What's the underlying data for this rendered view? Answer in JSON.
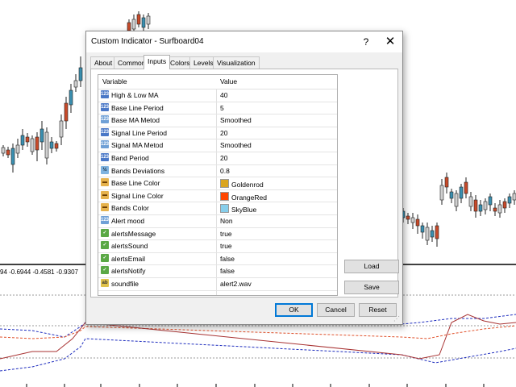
{
  "background": {
    "indicator_readout": "94 -0.6944 -0.4581 -0.9307",
    "line_colors": {
      "blue": "#1e2dbe",
      "red": "#e0502a",
      "brown": "#a83232"
    }
  },
  "dialog": {
    "title": "Custom Indicator - Surfboard04",
    "help_label": "?",
    "close_label": "✕",
    "tabs": [
      {
        "label": "About",
        "active": false
      },
      {
        "label": "Common",
        "active": false
      },
      {
        "label": "Inputs",
        "active": true
      },
      {
        "label": "Colors",
        "active": false
      },
      {
        "label": "Levels",
        "active": false
      },
      {
        "label": "Visualization",
        "active": false
      }
    ],
    "grid": {
      "headers": {
        "variable": "Variable",
        "value": "Value"
      },
      "rows": [
        {
          "name": "High & Low MA",
          "value": "40",
          "icon": "integer-icon",
          "icon_text": "123"
        },
        {
          "name": "Base Line Period",
          "value": "5",
          "icon": "integer-icon",
          "icon_text": "123"
        },
        {
          "name": "Base MA Metod",
          "value": "Smoothed",
          "icon": "enum-icon",
          "icon_text": "123"
        },
        {
          "name": "Signal Line Period",
          "value": "20",
          "icon": "integer-icon",
          "icon_text": "123"
        },
        {
          "name": "Signal MA Metod",
          "value": "Smoothed",
          "icon": "enum-icon",
          "icon_text": "123"
        },
        {
          "name": "Band Period",
          "value": "20",
          "icon": "integer-icon",
          "icon_text": "123"
        },
        {
          "name": "Bands Deviations",
          "value": "0.8",
          "icon": "double-icon",
          "icon_text": "½"
        },
        {
          "name": "Base Line Color",
          "value": "Goldenrod",
          "icon": "color-icon",
          "icon_text": "▬",
          "swatch": "#daa520"
        },
        {
          "name": "Signal Line Color",
          "value": "OrangeRed",
          "icon": "color-icon",
          "icon_text": "▬",
          "swatch": "#ff4500"
        },
        {
          "name": "Bands Color",
          "value": "SkyBlue",
          "icon": "color-icon",
          "icon_text": "▬",
          "swatch": "#87ceeb"
        },
        {
          "name": "Alert mood",
          "value": "Non",
          "icon": "enum-icon",
          "icon_text": "123"
        },
        {
          "name": "alertsMessage",
          "value": "true",
          "icon": "bool-icon",
          "icon_text": "✓"
        },
        {
          "name": "alertsSound",
          "value": "true",
          "icon": "bool-icon",
          "icon_text": "✓"
        },
        {
          "name": "alertsEmail",
          "value": "false",
          "icon": "bool-icon",
          "icon_text": "✓"
        },
        {
          "name": "alertsNotify",
          "value": "false",
          "icon": "bool-icon",
          "icon_text": "✓"
        },
        {
          "name": "soundfile",
          "value": "alert2.wav",
          "icon": "string-icon",
          "icon_text": "ab"
        }
      ]
    },
    "buttons": {
      "load": "Load",
      "save": "Save",
      "ok": "OK",
      "cancel": "Cancel",
      "reset": "Reset"
    }
  }
}
